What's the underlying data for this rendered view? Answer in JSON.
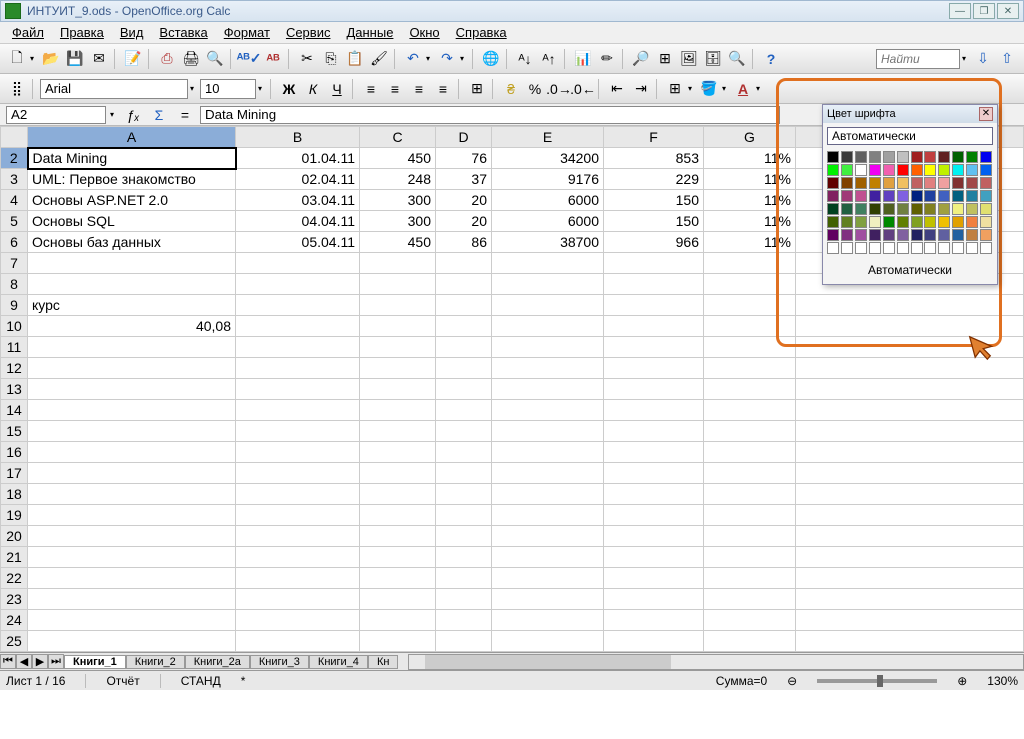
{
  "title": "ИНТУИТ_9.ods - OpenOffice.org Calc",
  "menu": [
    "Файл",
    "Правка",
    "Вид",
    "Вставка",
    "Формат",
    "Сервис",
    "Данные",
    "Окно",
    "Справка"
  ],
  "font": {
    "name": "Arial",
    "size": "10"
  },
  "search_placeholder": "Найти",
  "formula": {
    "ref": "A2",
    "value": "Data Mining"
  },
  "columns": [
    "A",
    "B",
    "C",
    "D",
    "E",
    "F",
    "G"
  ],
  "rows": [
    {
      "n": 2,
      "a": "Data Mining",
      "b": "01.04.11",
      "c": "450",
      "d": "76",
      "e": "34200",
      "f": "853",
      "g": "11%"
    },
    {
      "n": 3,
      "a": "UML: Первое знакомство",
      "b": "02.04.11",
      "c": "248",
      "d": "37",
      "e": "9176",
      "f": "229",
      "g": "11%"
    },
    {
      "n": 4,
      "a": "Основы ASP.NET 2.0",
      "b": "03.04.11",
      "c": "300",
      "d": "20",
      "e": "6000",
      "f": "150",
      "g": "11%"
    },
    {
      "n": 5,
      "a": "Основы SQL",
      "b": "04.04.11",
      "c": "300",
      "d": "20",
      "e": "6000",
      "f": "150",
      "g": "11%"
    },
    {
      "n": 6,
      "a": "Основы баз данных",
      "b": "05.04.11",
      "c": "450",
      "d": "86",
      "e": "38700",
      "f": "966",
      "g": "11%"
    }
  ],
  "extra_rows": {
    "r9a": "курс",
    "r10a": "40,08"
  },
  "empty_rows": [
    7,
    8,
    9,
    10,
    11,
    12,
    13,
    14,
    15,
    16,
    17,
    18,
    19,
    20,
    21,
    22,
    23,
    24,
    25
  ],
  "tabs": [
    "Книги_1",
    "Книги_2",
    "Книги_2a",
    "Книги_3",
    "Книги_4",
    "Кн"
  ],
  "status": {
    "sheet": "Лист 1 / 16",
    "style": "Отчёт",
    "mode": "СТАНД",
    "mod": "*",
    "sum": "Сумма=0",
    "zoom": "130%"
  },
  "color_popup": {
    "title": "Цвет шрифта",
    "auto_label": "Автоматически",
    "auto_btn": "Автоматически"
  },
  "swatches": [
    "#000000",
    "#383838",
    "#606060",
    "#808080",
    "#a0a0a0",
    "#c0c0c0",
    "#a02020",
    "#c04040",
    "#602020",
    "#006000",
    "#008000",
    "#0000f0",
    "#00f000",
    "#40f040",
    "#ffffff",
    "#f000f0",
    "#f060b0",
    "#ff0000",
    "#ff6000",
    "#ffff00",
    "#c0f000",
    "#00f0f0",
    "#60c0f0",
    "#0060f0",
    "#600000",
    "#804000",
    "#a06000",
    "#c08000",
    "#e0a040",
    "#f0c060",
    "#c06060",
    "#e08080",
    "#f0a0a0",
    "#803030",
    "#a04848",
    "#c06060",
    "#802060",
    "#a03878",
    "#c05090",
    "#4020a0",
    "#6040c0",
    "#8060e0",
    "#002080",
    "#2040a0",
    "#4060c0",
    "#006080",
    "#2080a0",
    "#40a0c0",
    "#004020",
    "#206040",
    "#408060",
    "#304000",
    "#506020",
    "#708040",
    "#606000",
    "#808020",
    "#a0a040",
    "#f0f080",
    "#c0c060",
    "#e0e070",
    "#406000",
    "#608020",
    "#80a040",
    "#f0f0c0",
    "#008800",
    "#608000",
    "#80a020",
    "#c0c000",
    "#f0c000",
    "#e0a000",
    "#f08040",
    "#f0e0a0",
    "#600060",
    "#803080",
    "#a050a0",
    "#402060",
    "#604080",
    "#8060a0",
    "#202060",
    "#404080",
    "#6060a0",
    "#2060a0",
    "#c08040",
    "#f0a060",
    "#ffffff",
    "#ffffff",
    "#ffffff",
    "#ffffff",
    "#ffffff",
    "#ffffff",
    "#ffffff",
    "#ffffff",
    "#ffffff",
    "#ffffff",
    "#ffffff",
    "#ffffff"
  ]
}
